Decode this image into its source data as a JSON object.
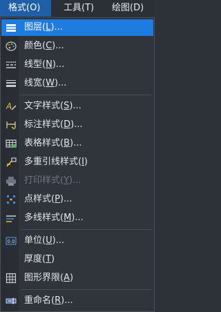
{
  "menubar": {
    "items": [
      "格式(O)",
      "工具(T)",
      "绘图(D)"
    ]
  },
  "menu": {
    "items": [
      {
        "pre": "图层(",
        "key": "L",
        "post": ")...",
        "icon": "layers-icon"
      },
      {
        "pre": "颜色(",
        "key": "C",
        "post": ")...",
        "icon": "color-palette-icon"
      },
      {
        "pre": "线型(",
        "key": "N",
        "post": ")...",
        "icon": "linetype-icon"
      },
      {
        "pre": "线宽(",
        "key": "W",
        "post": ")...",
        "icon": "lineweight-icon"
      },
      {
        "pre": "文字样式(",
        "key": "S",
        "post": ")...",
        "icon": "text-style-icon"
      },
      {
        "pre": "标注样式(",
        "key": "D",
        "post": ")...",
        "icon": "dimension-style-icon"
      },
      {
        "pre": "表格样式(",
        "key": "B",
        "post": ")...",
        "icon": "table-style-icon"
      },
      {
        "pre": "多重引线样式(",
        "key": "I",
        "post": ")",
        "icon": "multileader-style-icon"
      },
      {
        "pre": "打印样式(",
        "key": "Y",
        "post": ")...",
        "icon": "print-style-icon"
      },
      {
        "pre": "点样式(",
        "key": "P",
        "post": ")...",
        "icon": "point-style-icon"
      },
      {
        "pre": "多线样式(",
        "key": "M",
        "post": ")...",
        "icon": "multiline-style-icon"
      },
      {
        "pre": "单位(",
        "key": "U",
        "post": ")...",
        "icon": "units-icon"
      },
      {
        "pre": "厚度(",
        "key": "T",
        "post": ")",
        "icon": "thickness-icon"
      },
      {
        "pre": "图形界限(",
        "key": "A",
        "post": ")",
        "icon": "drawing-limits-icon"
      },
      {
        "pre": "重命名(",
        "key": "R",
        "post": ")...",
        "icon": "rename-icon"
      }
    ]
  },
  "colors": {
    "highlight": "#1e7be0",
    "menu_bg": "#30343b",
    "text": "#e3e6ea",
    "disabled_text": "#6e7480"
  }
}
